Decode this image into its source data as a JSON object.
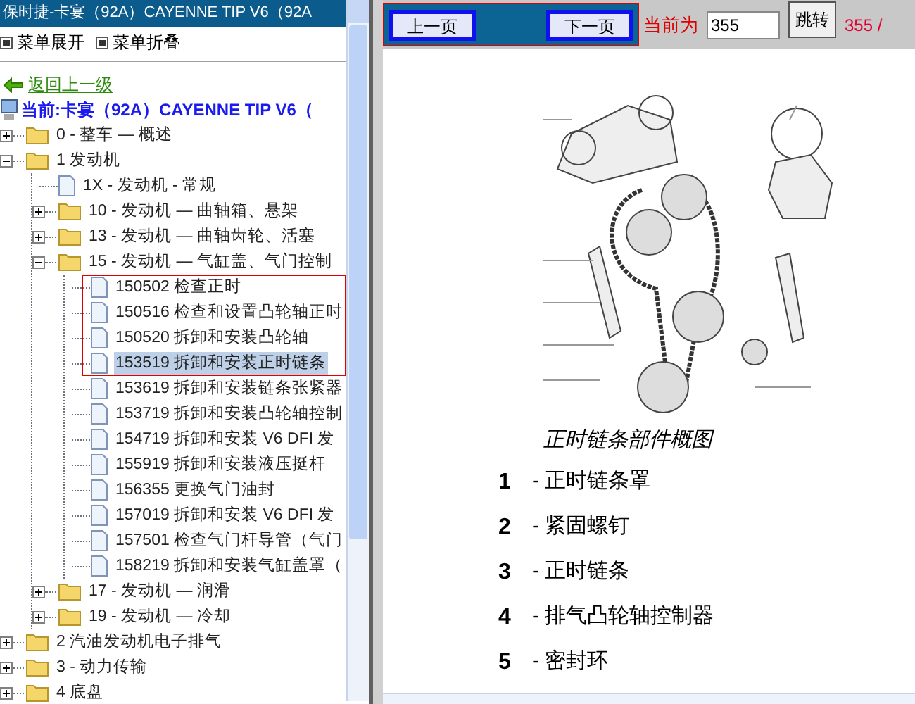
{
  "left_pane": {
    "title": "保时捷-卡宴（92A）CAYENNE TIP V6（92A",
    "menu": [
      {
        "label": "菜单展开"
      },
      {
        "label": "菜单折叠"
      }
    ],
    "back_link": "返回上一级",
    "current": "当前:卡宴（92A）CAYENNE TIP V6（",
    "tree": [
      {
        "label": "0 - 整车 — 概述",
        "kind": "folder",
        "expanded": false,
        "selected": false
      },
      {
        "label": "1 发动机",
        "kind": "folder",
        "expanded": true,
        "selected": false,
        "children": [
          {
            "label": "1X - 发动机 - 常规",
            "kind": "doc",
            "selected": false
          },
          {
            "label": "10 - 发动机 — 曲轴箱、悬架",
            "kind": "folder",
            "expanded": false,
            "selected": false
          },
          {
            "label": "13 - 发动机 — 曲轴齿轮、活塞",
            "kind": "folder",
            "expanded": false,
            "selected": false
          },
          {
            "label": "15 - 发动机 — 气缸盖、气门控制",
            "kind": "folder",
            "expanded": true,
            "selected": false,
            "children": [
              {
                "label": "150502 检查正时",
                "kind": "doc",
                "selected": false
              },
              {
                "label": "150516 检查和设置凸轮轴正时",
                "kind": "doc",
                "selected": false
              },
              {
                "label": "150520 拆卸和安装凸轮轴",
                "kind": "doc",
                "selected": false
              },
              {
                "label": "153519 拆卸和安装正时链条",
                "kind": "doc",
                "selected": true
              },
              {
                "label": "153619 拆卸和安装链条张紧器",
                "kind": "doc",
                "selected": false
              },
              {
                "label": "153719 拆卸和安装凸轮轴控制",
                "kind": "doc",
                "selected": false
              },
              {
                "label": "154719 拆卸和安装 V6 DFI 发",
                "kind": "doc",
                "selected": false
              },
              {
                "label": "155919 拆卸和安装液压挺杆",
                "kind": "doc",
                "selected": false
              },
              {
                "label": "156355 更换气门油封",
                "kind": "doc",
                "selected": false
              },
              {
                "label": "157019 拆卸和安装 V6 DFI 发",
                "kind": "doc",
                "selected": false
              },
              {
                "label": "157501 检查气门杆导管（气门",
                "kind": "doc",
                "selected": false
              },
              {
                "label": "158219 拆卸和安装气缸盖罩（",
                "kind": "doc",
                "selected": false
              }
            ]
          },
          {
            "label": "17 - 发动机 — 润滑",
            "kind": "folder",
            "expanded": false,
            "selected": false
          },
          {
            "label": "19 - 发动机 — 冷却",
            "kind": "folder",
            "expanded": false,
            "selected": false
          }
        ]
      },
      {
        "label": "2 汽油发动机电子排气",
        "kind": "folder",
        "expanded": false,
        "selected": false
      },
      {
        "label": "3 - 动力传输",
        "kind": "folder",
        "expanded": false,
        "selected": false
      },
      {
        "label": "4 底盘",
        "kind": "folder",
        "expanded": false,
        "selected": false
      }
    ]
  },
  "toolbar": {
    "prev_button": "上一页",
    "next_button": "下一页",
    "page_label": "当前为",
    "page_input": "355",
    "go_button": "跳转",
    "page_count": "355 /"
  },
  "content": {
    "caption": "正时链条部件概图",
    "legend": [
      {
        "number": "1",
        "text": "- 正时链条罩"
      },
      {
        "number": "2",
        "text": "- 紧固螺钉"
      },
      {
        "number": "3",
        "text": "- 正时链条"
      },
      {
        "number": "4",
        "text": "- 排气凸轮轴控制器"
      },
      {
        "number": "5",
        "text": "- 密封环"
      }
    ]
  }
}
